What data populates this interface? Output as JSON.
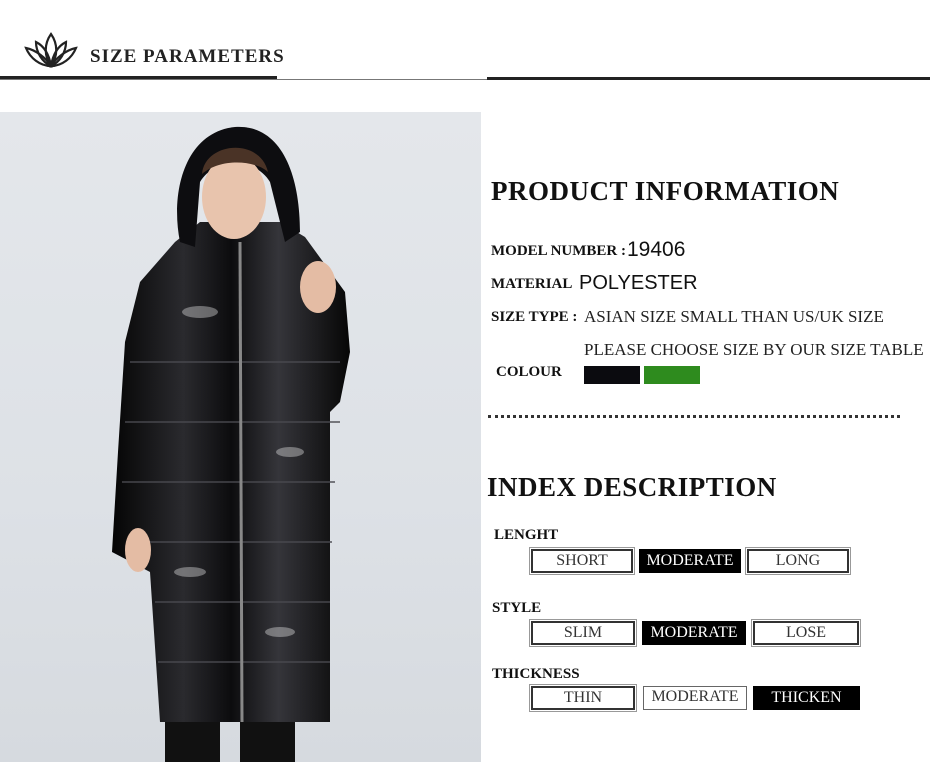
{
  "header": {
    "title": "SIZE PARAMETERS",
    "logo_icon": "lotus-icon"
  },
  "product_information": {
    "title": "PRODUCT INFORMATION",
    "model_number_label": "MODEL NUMBER :",
    "model_number_value": "19406",
    "material_label": "MATERIAL",
    "material_value": "POLYESTER",
    "size_type_label": "SIZE TYPE :",
    "size_type_line1": "ASIAN SIZE SMALL THAN US/UK SIZE",
    "size_type_line2": "PLEASE CHOOSE SIZE BY OUR SIZE TABLE",
    "colour_label": "COLOUR",
    "colours": [
      "#0b0b0f",
      "#2e8b1e"
    ]
  },
  "index_description": {
    "title": "INDEX DESCRIPTION",
    "length": {
      "label": "LENGHT",
      "options": [
        "SHORT",
        "MODERATE",
        "LONG"
      ],
      "selected": "MODERATE"
    },
    "style": {
      "label": "STYLE",
      "options": [
        "SLIM",
        "MODERATE",
        "LOSE"
      ],
      "selected": "MODERATE"
    },
    "thickness": {
      "label": "THICKNESS",
      "options": [
        "THIN",
        "MODERATE",
        "THICKEN"
      ],
      "selected": "THICKEN"
    }
  }
}
